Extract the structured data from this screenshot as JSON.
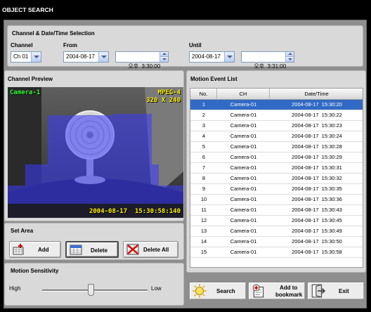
{
  "title": "OBJECT SEARCH",
  "selection": {
    "title": "Channel & Date/Time Selection",
    "channel_label": "Channel",
    "channel_value": "Ch 01",
    "from_label": "From",
    "from_date": "2004-08-17",
    "from_time": "오후  3:30:00",
    "until_label": "Until",
    "until_date": "2004-08-17",
    "until_time": "오후  3:31:00"
  },
  "preview": {
    "title": "Channel Preview",
    "camera_label": "Camera-1",
    "codec": "MPEG-4",
    "resolution": "320 X 240",
    "timestamp": "2004-08-17  15:30:58:140"
  },
  "set_area": {
    "title": "Set Area",
    "add_label": "Add",
    "delete_label": "Delete",
    "delete_all_label": "Delete All"
  },
  "sensitivity": {
    "title": "Motion Sensitivity",
    "high_label": "High",
    "low_label": "Low",
    "level": 0.46
  },
  "events": {
    "title": "Motion Event List",
    "columns": [
      "No.",
      "CH",
      "Date/Time"
    ],
    "selected_index": 0,
    "rows": [
      {
        "no": "1",
        "ch": "Camera-01",
        "datetime": "2004-08-17  15:30:20"
      },
      {
        "no": "2",
        "ch": "Camera-01",
        "datetime": "2004-08-17  15:30:22"
      },
      {
        "no": "3",
        "ch": "Camera-01",
        "datetime": "2004-08-17  15:30:23"
      },
      {
        "no": "4",
        "ch": "Camera-01",
        "datetime": "2004-08-17  15:30:24"
      },
      {
        "no": "5",
        "ch": "Camera-01",
        "datetime": "2004-08-17  15:30:28"
      },
      {
        "no": "6",
        "ch": "Camera-01",
        "datetime": "2004-08-17  15:30:29"
      },
      {
        "no": "7",
        "ch": "Camera-01",
        "datetime": "2004-08-17  15:30:31"
      },
      {
        "no": "8",
        "ch": "Camera-01",
        "datetime": "2004-08-17  15:30:32"
      },
      {
        "no": "9",
        "ch": "Camera-01",
        "datetime": "2004-08-17  15:30:35"
      },
      {
        "no": "10",
        "ch": "Camera-01",
        "datetime": "2004-08-17  15:30:36"
      },
      {
        "no": "11",
        "ch": "Camera-01",
        "datetime": "2004-08-17  15:30:43"
      },
      {
        "no": "12",
        "ch": "Camera-01",
        "datetime": "2004-08-17  15:30:45"
      },
      {
        "no": "13",
        "ch": "Camera-01",
        "datetime": "2004-08-17  15:30:49"
      },
      {
        "no": "14",
        "ch": "Camera-01",
        "datetime": "2004-08-17  15:30:50"
      },
      {
        "no": "15",
        "ch": "Camera-01",
        "datetime": "2004-08-17  15:30:58"
      }
    ]
  },
  "actions": {
    "search_label": "Search",
    "bookmark_line1": "Add to",
    "bookmark_line2": "bookmark",
    "exit_label": "Exit"
  },
  "colors": {
    "selected_row": "#316ac5",
    "osd_text": "#fff200",
    "motion_overlay": "#3c3cff"
  },
  "icons": [
    "add-area-icon",
    "delete-area-icon",
    "delete-all-icon",
    "search-icon",
    "bookmark-icon",
    "exit-icon"
  ]
}
